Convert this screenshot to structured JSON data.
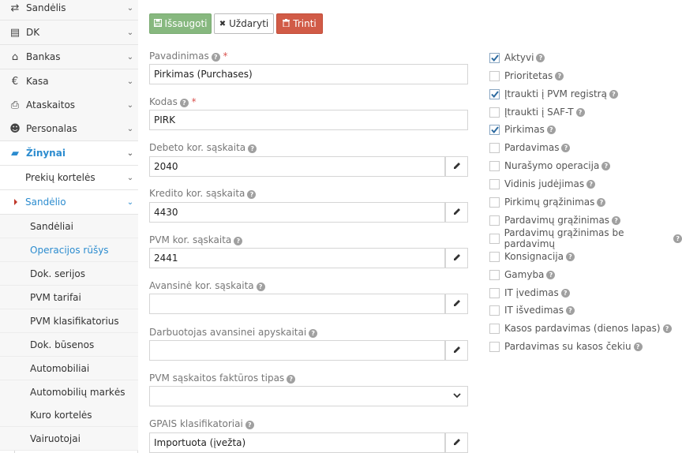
{
  "sidebar": {
    "items": [
      {
        "label": "Sandėlis",
        "icon": "exchange-icon",
        "glyph": "⇄"
      },
      {
        "label": "DK",
        "icon": "book-icon",
        "glyph": "▤"
      },
      {
        "label": "Bankas",
        "icon": "bank-icon",
        "glyph": "⌂"
      },
      {
        "label": "Kasa",
        "icon": "euro-icon",
        "glyph": "€"
      },
      {
        "label": "Ataskaitos",
        "icon": "print-icon",
        "glyph": "⎙"
      },
      {
        "label": "Personalas",
        "icon": "users-icon",
        "glyph": "☻"
      },
      {
        "label": "Žinynai",
        "icon": "folder-open-icon",
        "glyph": "▰"
      }
    ],
    "sub_items": [
      {
        "label": "Prekių kortelės"
      },
      {
        "label": "Sandėlio"
      }
    ],
    "subsub_items": [
      {
        "label": "Sandėliai"
      },
      {
        "label": "Operacijos rūšys"
      },
      {
        "label": "Dok. serijos"
      },
      {
        "label": "PVM tarifai"
      },
      {
        "label": "PVM klasifikatorius"
      },
      {
        "label": "Dok. būsenos"
      },
      {
        "label": "Automobiliai"
      },
      {
        "label": "Automobilių markės"
      },
      {
        "label": "Kuro kortelės"
      },
      {
        "label": "Vairuotojai"
      }
    ]
  },
  "toolbar": {
    "save_label": "Išsaugoti",
    "close_label": "Uždaryti",
    "delete_label": "Trinti"
  },
  "form": {
    "fields": [
      {
        "label": "Pavadinimas",
        "value": "Pirkimas  (Purchases)",
        "required": "*"
      },
      {
        "label": "Kodas",
        "value": "PIRK",
        "required": "*"
      },
      {
        "label": "Debeto kor. sąskaita",
        "value": "2040"
      },
      {
        "label": "Kredito kor. sąskaita",
        "value": "4430"
      },
      {
        "label": "PVM kor. sąskaita",
        "value": "2441"
      },
      {
        "label": "Avansinė kor. sąskaita",
        "value": ""
      },
      {
        "label": "Darbuotojas avansinei apyskaitai",
        "value": ""
      },
      {
        "label": "PVM sąskaitos faktūros tipas",
        "value": ""
      },
      {
        "label": "GPAIS klasifikatoriai",
        "value": "Importuota (įvežta)"
      }
    ]
  },
  "checkboxes": [
    {
      "label": "Aktyvi",
      "checked": true
    },
    {
      "label": "Prioritetas",
      "checked": false
    },
    {
      "label": "Įtraukti į PVM registrą",
      "checked": true
    },
    {
      "label": "Įtraukti į SAF-T",
      "checked": false
    },
    {
      "label": "Pirkimas",
      "checked": true
    },
    {
      "label": "Pardavimas",
      "checked": false
    },
    {
      "label": "Nurašymo operacija",
      "checked": false
    },
    {
      "label": "Vidinis judėjimas",
      "checked": false
    },
    {
      "label": "Pirkimų grąžinimas",
      "checked": false
    },
    {
      "label": "Pardavimų grąžinimas",
      "checked": false
    },
    {
      "label": "Pardavimų grąžinimas be pardavimų",
      "checked": false
    },
    {
      "label": "Konsignacija",
      "checked": false
    },
    {
      "label": "Gamyba",
      "checked": false
    },
    {
      "label": "IT įvedimas",
      "checked": false
    },
    {
      "label": "IT išvedimas",
      "checked": false
    },
    {
      "label": "Kasos pardavimas (dienos lapas)",
      "checked": false
    },
    {
      "label": "Pardavimas su kasos čekiu",
      "checked": false
    }
  ],
  "help_glyph": "?",
  "colors": {
    "accent": "#2c8ccf",
    "save": "#87b87f",
    "delete": "#d15b47"
  }
}
